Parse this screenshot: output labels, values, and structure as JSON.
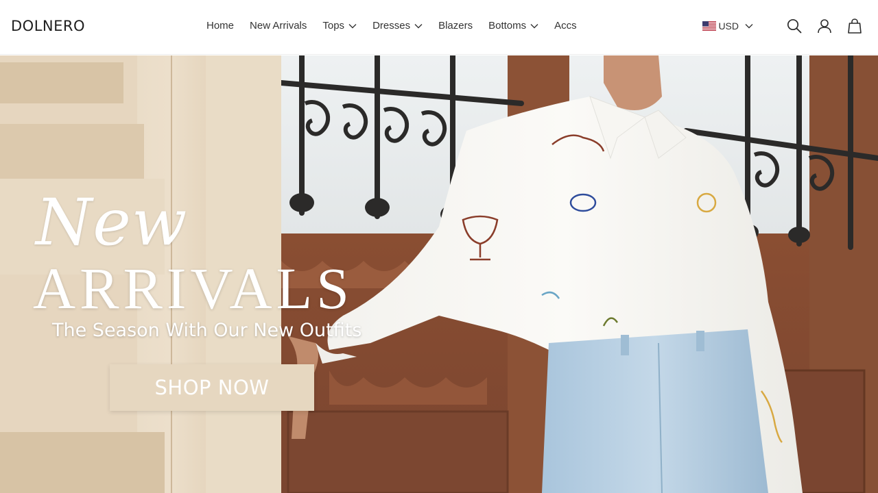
{
  "header": {
    "logo": "DOLNERO",
    "nav": [
      {
        "label": "Home",
        "has_dropdown": false
      },
      {
        "label": "New Arrivals",
        "has_dropdown": false
      },
      {
        "label": "Tops",
        "has_dropdown": true
      },
      {
        "label": "Dresses",
        "has_dropdown": true
      },
      {
        "label": "Blazers",
        "has_dropdown": false
      },
      {
        "label": "Bottoms",
        "has_dropdown": true
      },
      {
        "label": "Accs",
        "has_dropdown": false
      }
    ],
    "currency": {
      "label": "USD",
      "flag_icon": "us-flag-icon"
    },
    "icons": [
      "search-icon",
      "account-icon",
      "cart-bag-icon"
    ]
  },
  "hero": {
    "script_title": "New",
    "title": "ARRIVALS",
    "tagline": "The Season With Our New Outfits",
    "cta_label": "SHOP NOW",
    "cta_color": "#e6d7c0"
  }
}
